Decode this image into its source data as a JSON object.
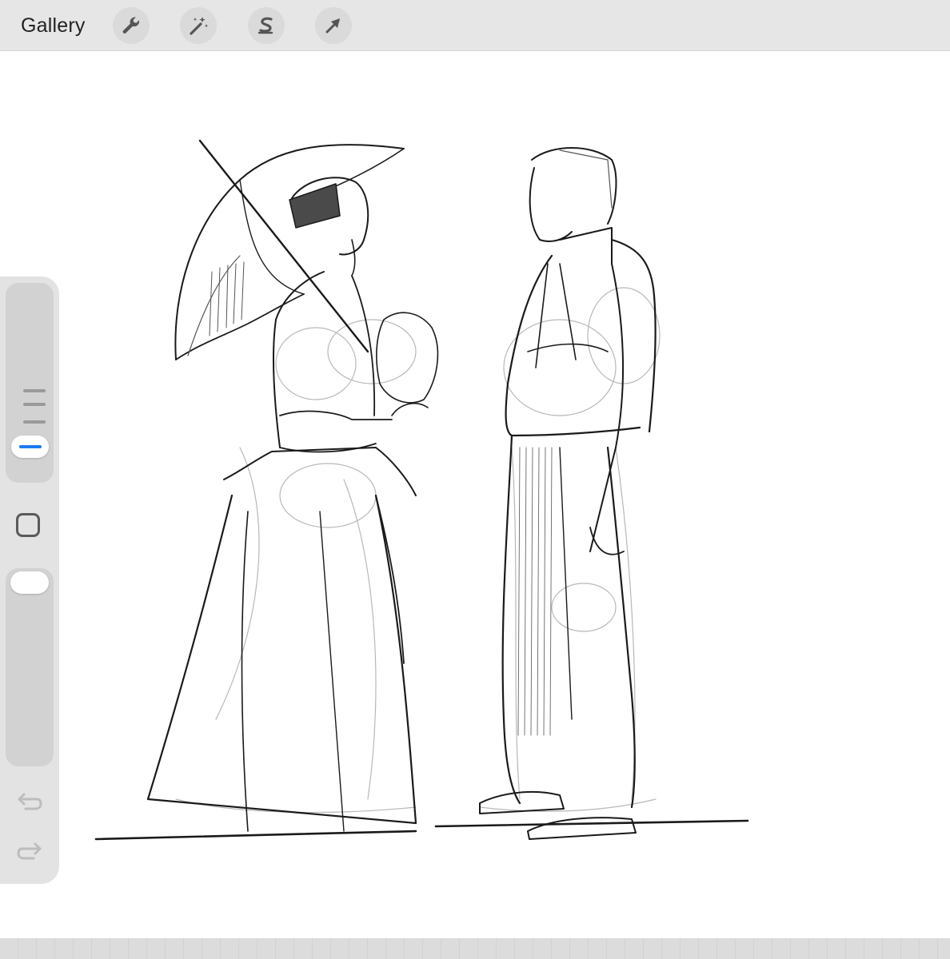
{
  "toolbar": {
    "gallery_label": "Gallery",
    "tools": [
      {
        "name": "actions",
        "icon": "wrench-icon"
      },
      {
        "name": "adjustments",
        "icon": "magic-wand-icon"
      },
      {
        "name": "selection",
        "icon": "selection-s-icon"
      },
      {
        "name": "transform",
        "icon": "arrow-cursor-icon"
      }
    ]
  },
  "sidebar": {
    "brush_size_icon": "brush-size-slider",
    "modify_icon": "square-modify-icon",
    "opacity_icon": "opacity-slider",
    "undo_icon": "undo-icon",
    "redo_icon": "redo-icon"
  },
  "canvas": {
    "content": "pencil-sketch",
    "ink_color": "#1a1a1a"
  },
  "colors": {
    "toolbar_bg": "#e6e6e6",
    "sidebar_bg": "#e3e3e3",
    "slider_bg": "#d2d2d2",
    "accent": "#1a7cf5",
    "icon": "#555555"
  }
}
